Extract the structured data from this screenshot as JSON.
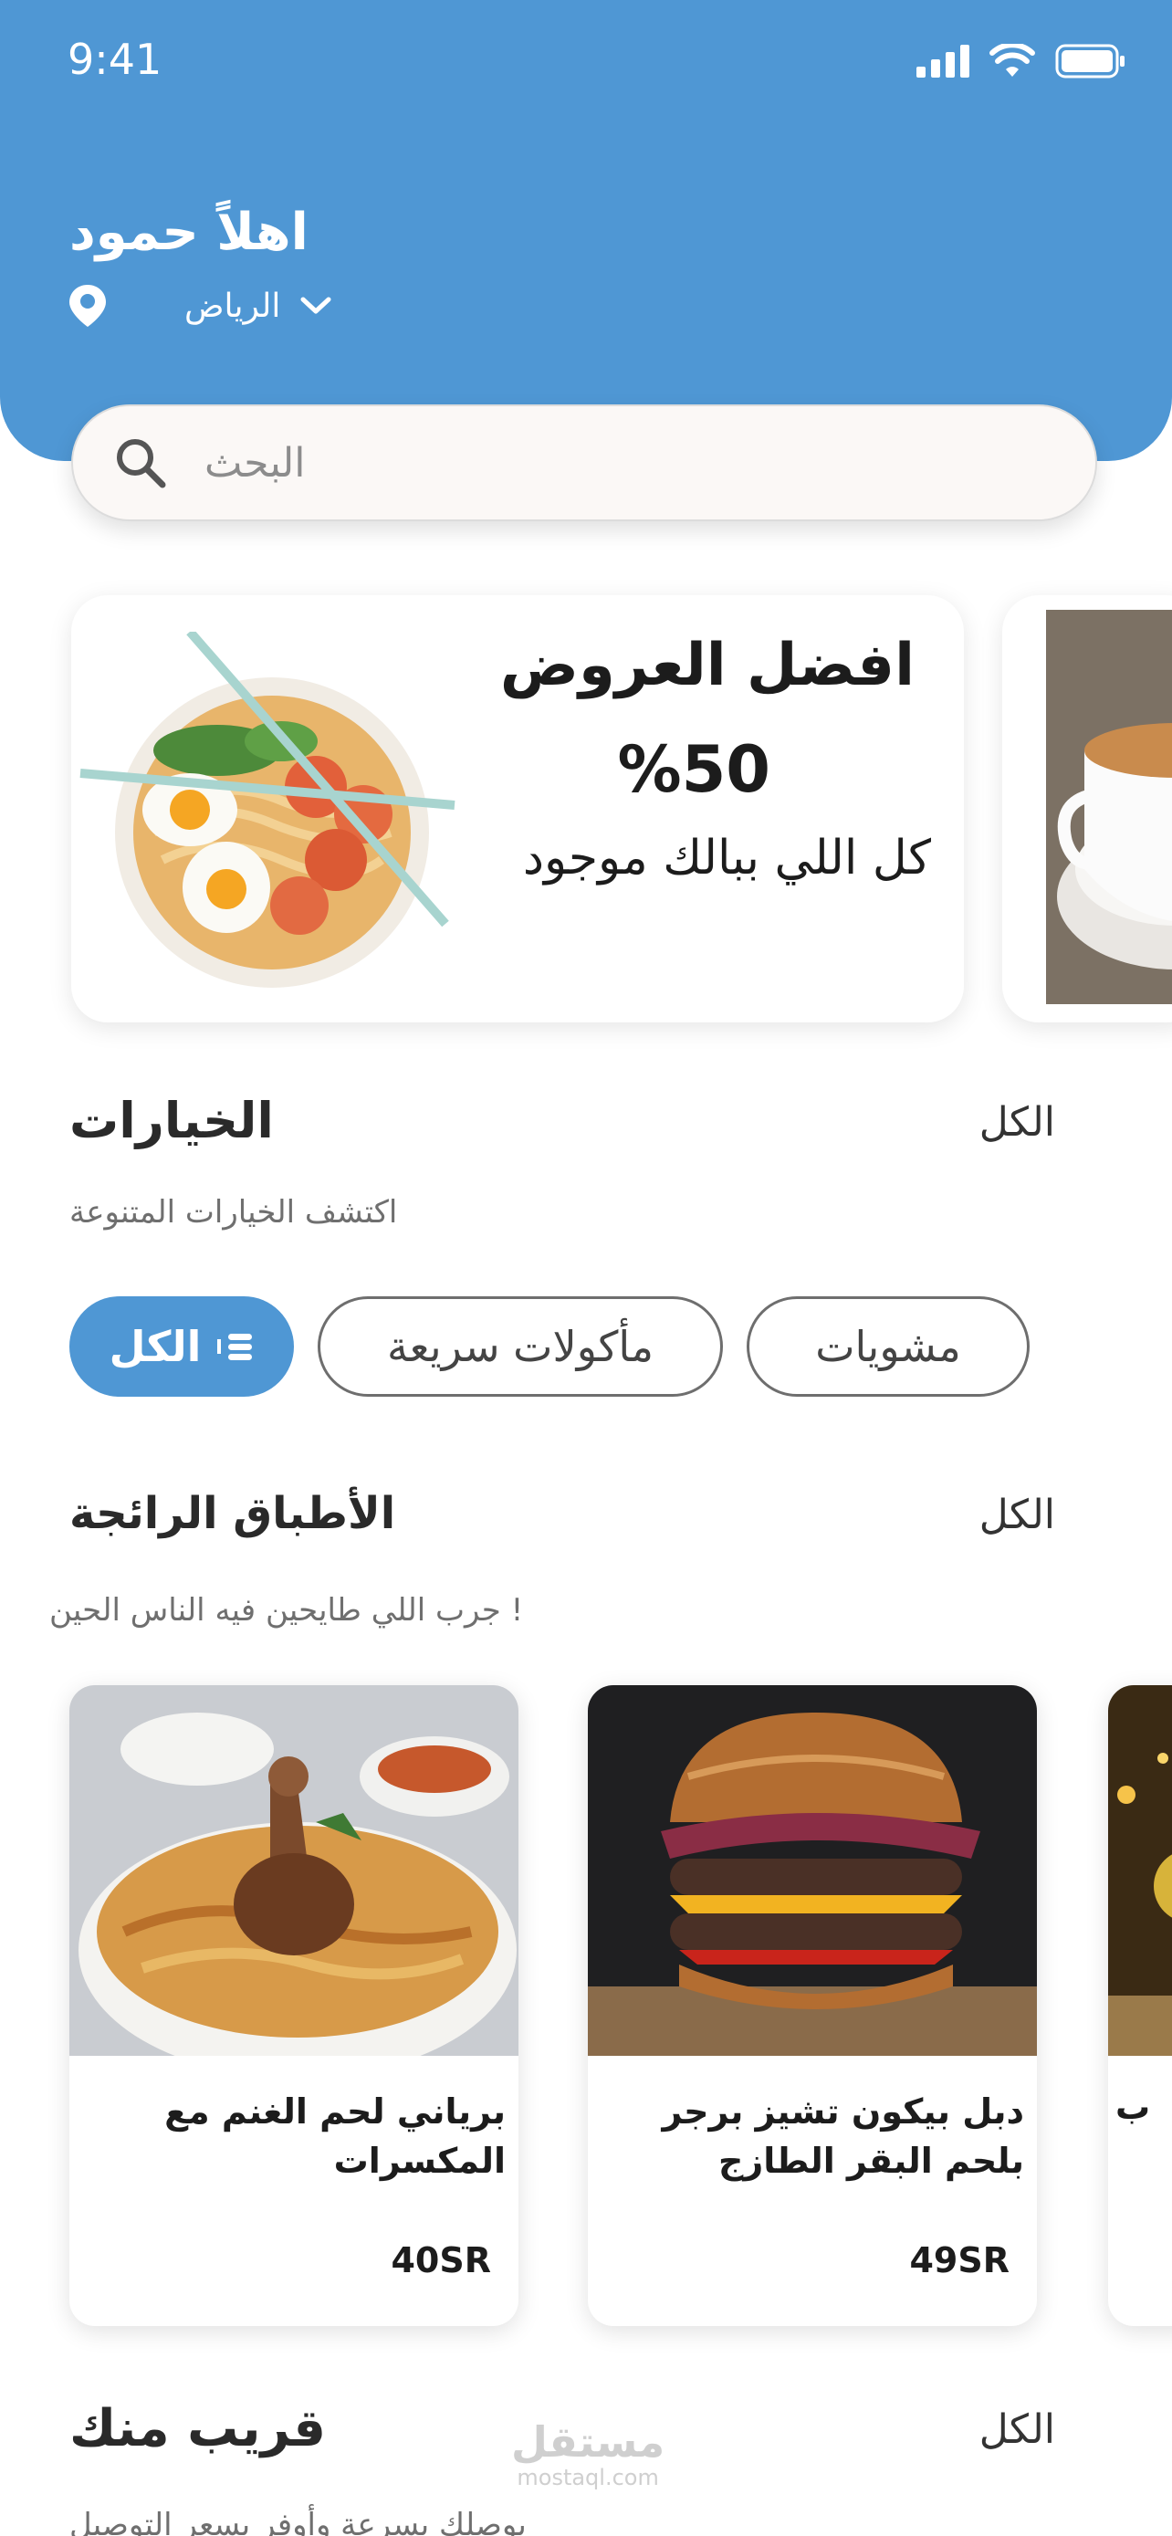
{
  "status_bar": {
    "time": "9:41"
  },
  "header": {
    "greeting": "اهلاً حمود",
    "city": "الرياض",
    "location_icon": "location-pin-icon",
    "dropdown_icon": "chevron-down-icon"
  },
  "search": {
    "placeholder": "البحث"
  },
  "promo": {
    "title": "افضل العروض",
    "percent": "%50",
    "subtitle": "كل اللي ببالك موجود"
  },
  "options": {
    "title": "الخيارات",
    "all_label": "الكل",
    "subtitle": "اكتشف الخيارات المتنوعة",
    "chips": [
      {
        "label": "الكل",
        "active": true
      },
      {
        "label": "مأكولات سريعة",
        "active": false
      },
      {
        "label": "مشويات",
        "active": false
      }
    ]
  },
  "popular": {
    "title": "الأطباق الرائجة",
    "all_label": "الكل",
    "subtitle": "جرب اللي طايحين فيه الناس الحين !",
    "items": [
      {
        "name": "برياني لحم الغنم مع المكسرات",
        "price": "40SR"
      },
      {
        "name": "دبل بيكون تشيز برجر بلحم البقر الطازج",
        "price": "49SR"
      },
      {
        "name": "ب",
        "price": ""
      }
    ]
  },
  "nearby": {
    "title": "قريب منك",
    "all_label": "الكل",
    "subtitle": "يوصلك بسرعة وأوفر بسعر التوصيل"
  },
  "watermark": {
    "arabic": "مستقل",
    "latin": "mostaql.com"
  },
  "colors": {
    "primary": "#4f97d4",
    "text": "#1c1c1c",
    "muted": "#6f6f6f"
  }
}
